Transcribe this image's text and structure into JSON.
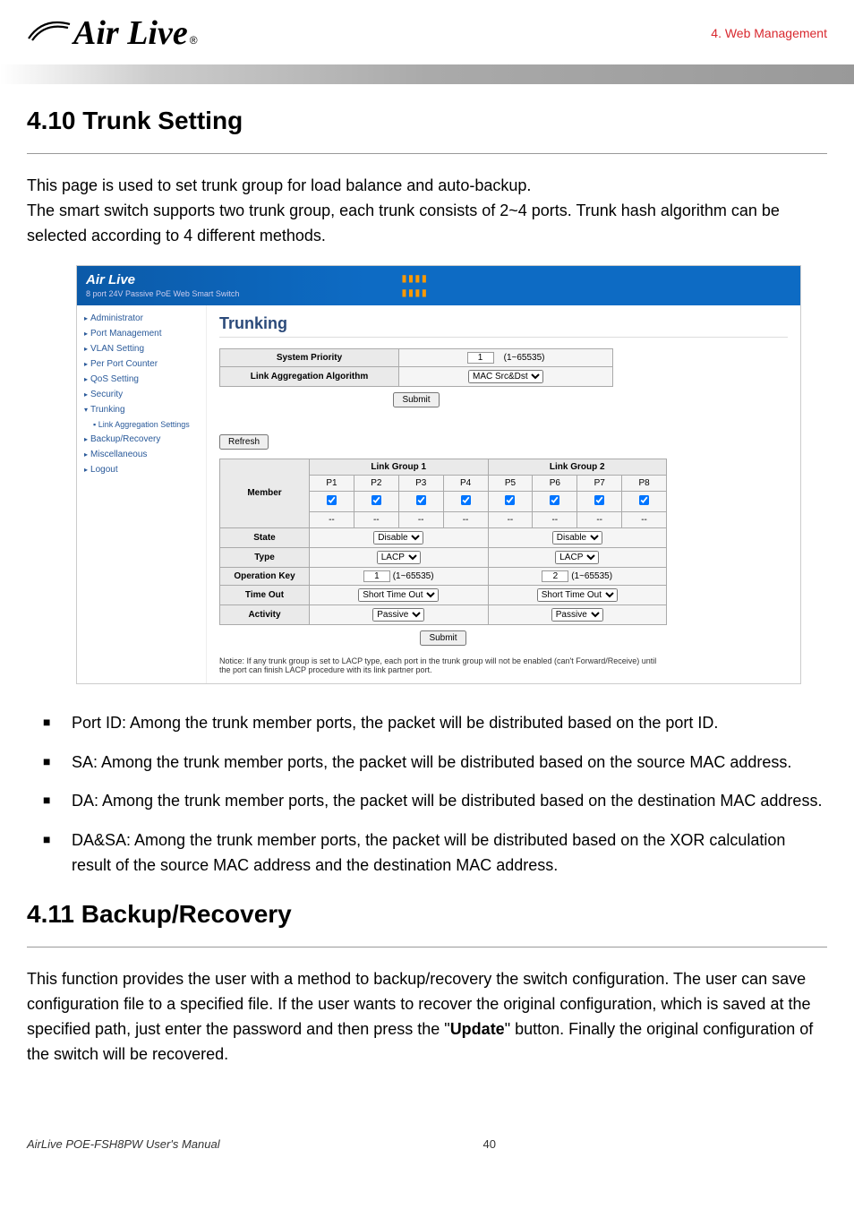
{
  "header": {
    "brand": "Air Live",
    "reg": "®",
    "crumb": "4. Web Management"
  },
  "sections": {
    "s1_title": "4.10 Trunk Setting",
    "s1_p1": "This page is used to set trunk group for load balance and auto-backup.",
    "s1_p2": "The smart switch supports two trunk group, each trunk consists of 2~4 ports. Trunk hash algorithm can be selected according to 4 different methods.",
    "s2_title": "4.11 Backup/Recovery",
    "s2_p1a": "This function provides the user with a method to backup/recovery the switch configuration. The user can save configuration file to a specified file. If the user wants to recover the original configuration, which is saved at the specified path, just enter the password and then press the \"",
    "s2_p1_bold": "Update",
    "s2_p1b": "\" button. Finally the original configuration of the switch will be recovered."
  },
  "bullets": {
    "b1": "Port ID: Among the trunk member ports, the packet will be distributed based on the port ID.",
    "b2": "SA: Among the trunk member ports, the packet will be distributed based on the source MAC address.",
    "b3": "DA: Among the trunk member ports, the packet will be distributed based on the destination MAC address.",
    "b4": "DA&SA: Among the trunk member ports, the packet will be distributed based on the XOR calculation result of the source MAC address and the destination MAC address."
  },
  "screenshot": {
    "brand": "Air Live",
    "brand_sub": "8 port 24V Passive PoE Web Smart Switch",
    "nav": {
      "items": [
        "Administrator",
        "Port Management",
        "VLAN Setting",
        "Per Port Counter",
        "QoS Setting",
        "Security",
        "Trunking",
        "Link Aggregation Settings",
        "Backup/Recovery",
        "Miscellaneous",
        "Logout"
      ]
    },
    "title": "Trunking",
    "priority_label": "System Priority",
    "priority_value": "1",
    "priority_range": "(1~65535)",
    "algo_label": "Link Aggregation Algorithm",
    "algo_value": "MAC Src&Dst",
    "submit": "Submit",
    "refresh": "Refresh",
    "groups": {
      "g1": "Link Group 1",
      "g2": "Link Group 2",
      "p1": "P1",
      "p2": "P2",
      "p3": "P3",
      "p4": "P4",
      "p5": "P5",
      "p6": "P6",
      "p7": "P7",
      "p8": "P8",
      "member": "Member",
      "dash": "--",
      "state": "State",
      "state_v": "Disable",
      "type": "Type",
      "type_v": "LACP",
      "opkey": "Operation Key",
      "opkey_v1": "1",
      "opkey_v2": "2",
      "opkey_range": "(1~65535)",
      "timeout": "Time Out",
      "timeout_v": "Short Time Out",
      "activity": "Activity",
      "activity_v": "Passive"
    },
    "note": "Notice: If any trunk group is set to LACP type, each port in the trunk group will not be enabled (can't Forward/Receive) until the port can finish LACP procedure with its link partner port."
  },
  "footer": {
    "manual": "AirLive POE-FSH8PW User's Manual",
    "page": "40"
  }
}
